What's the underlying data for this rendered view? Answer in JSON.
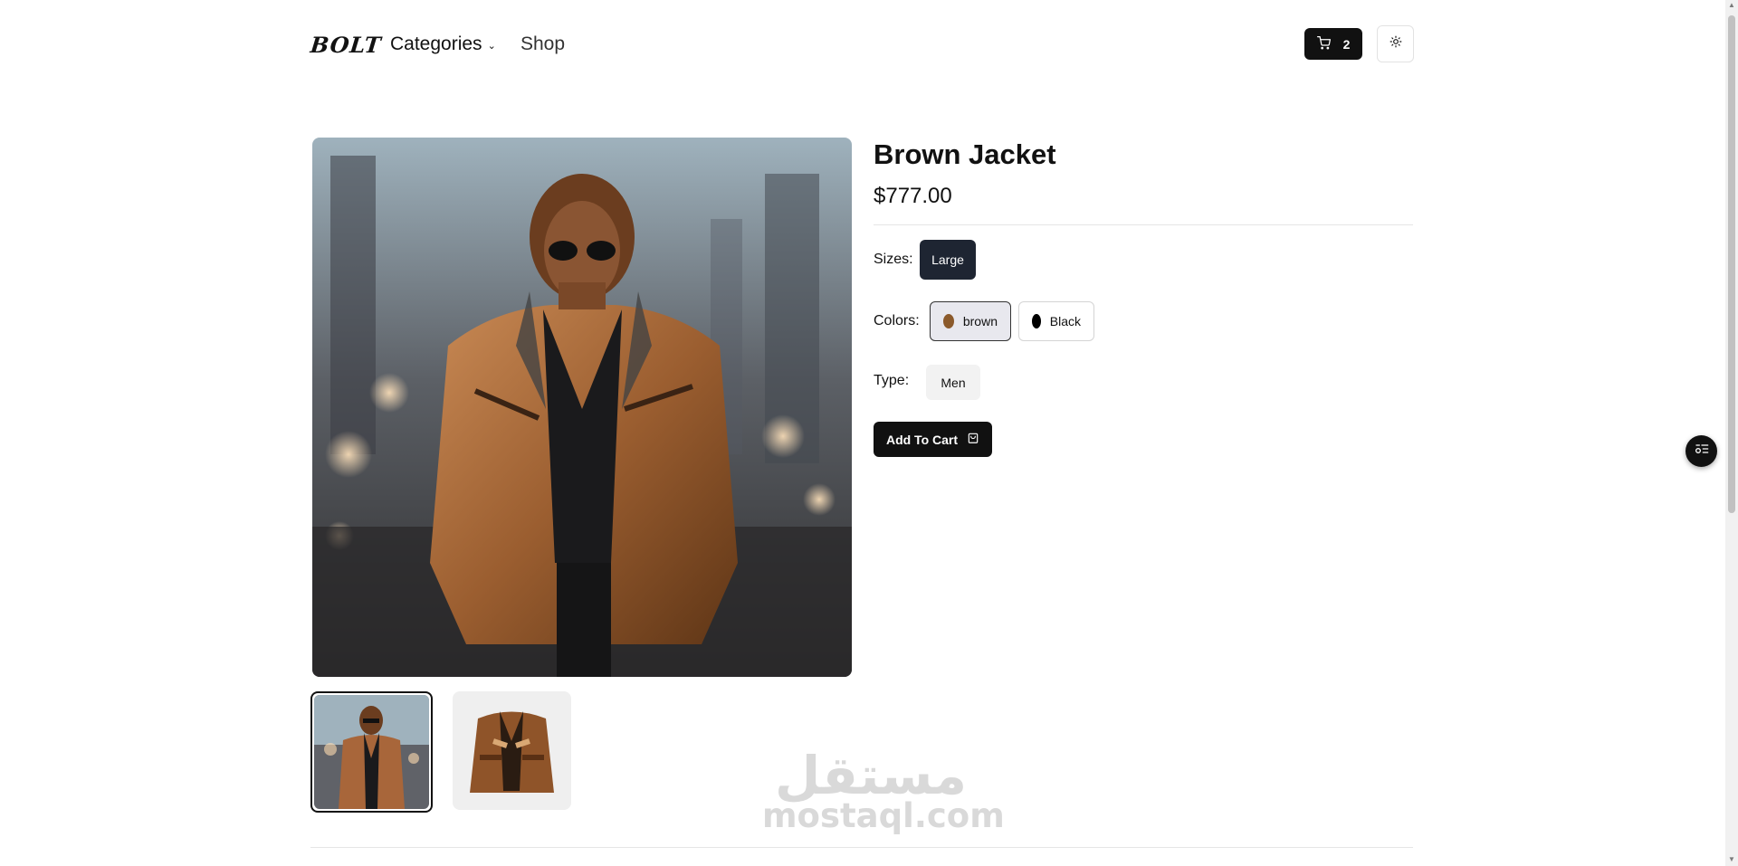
{
  "header": {
    "logo": "BOLT",
    "nav_categories": "Categories",
    "nav_shop": "Shop",
    "cart_count": "2"
  },
  "product": {
    "title": "Brown Jacket",
    "price": "$777.00",
    "sizes_label": "Sizes:",
    "size_selected": "Large",
    "colors_label": "Colors:",
    "colors": [
      {
        "name": "brown",
        "swatch": "#8b5a2b"
      },
      {
        "name": "Black",
        "swatch": "#000000"
      }
    ],
    "type_label": "Type:",
    "type_value": "Men",
    "add_to_cart": "Add To Cart"
  },
  "watermark": {
    "arabic": "مستقل",
    "latin": "mostaql.com"
  },
  "theme": {
    "accent": "#111111",
    "size_selected_bg": "#1e2532"
  }
}
